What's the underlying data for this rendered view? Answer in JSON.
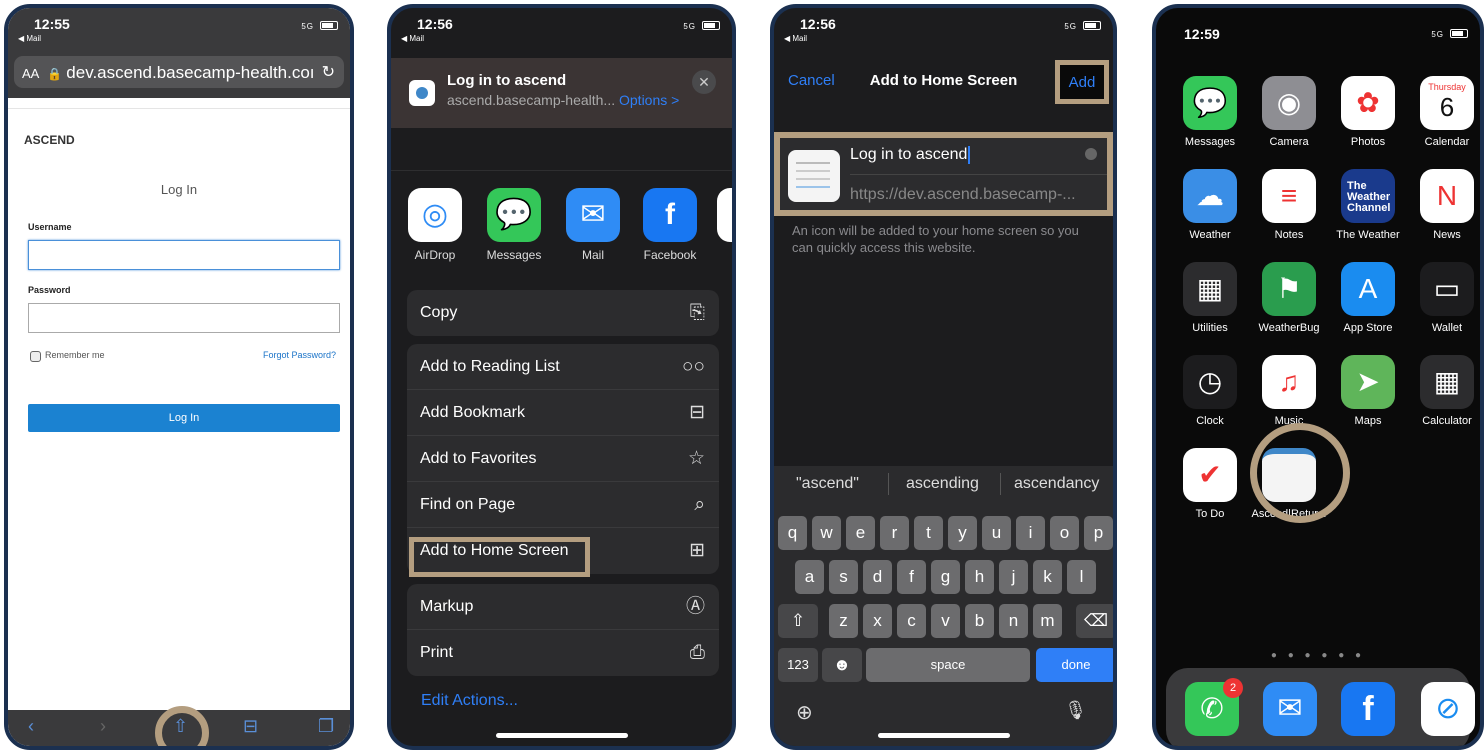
{
  "phone1": {
    "time": "12:55",
    "back_app": "◀ Mail",
    "signal": "5G",
    "url": {
      "text_size": "AA",
      "address": "dev.ascend.basecamp-health.coı"
    },
    "brand": "ASCEND",
    "title": "Log In",
    "username_label": "Username",
    "password_label": "Password",
    "remember": "Remember me",
    "forgot": "Forgot Password?",
    "login_button": "Log In"
  },
  "phone2": {
    "time": "12:56",
    "back_app": "◀ Mail",
    "signal": "5G",
    "sheet_title": "Log in to ascend",
    "sheet_url": "ascend.basecamp-health...",
    "options": "Options >",
    "apps": [
      {
        "label": "AirDrop",
        "icon": "airdrop-icon",
        "color": "#ffffff"
      },
      {
        "label": "Messages",
        "icon": "messages-icon",
        "color": "#34c759"
      },
      {
        "label": "Mail",
        "icon": "mail-icon",
        "color": "#2f8cf5"
      },
      {
        "label": "Facebook",
        "icon": "facebook-icon",
        "color": "#1877f2"
      }
    ],
    "copy": "Copy",
    "actions": [
      "Add to Reading List",
      "Add Bookmark",
      "Add to Favorites",
      "Find on Page",
      "Add to Home Screen"
    ],
    "markup": "Markup",
    "print": "Print",
    "edit_actions": "Edit Actions..."
  },
  "phone3": {
    "time": "12:56",
    "back_app": "◀ Mail",
    "signal": "5G",
    "cancel": "Cancel",
    "title": "Add to Home Screen",
    "add": "Add",
    "name_value": "Log in to ascend",
    "url_value": "https://dev.ascend.basecamp-...",
    "note": "An icon will be added to your home screen so you can quickly access this website.",
    "suggestions": [
      "\"ascend\"",
      "ascending",
      "ascendancy"
    ],
    "keys": {
      "row1": [
        "q",
        "w",
        "e",
        "r",
        "t",
        "y",
        "u",
        "i",
        "o",
        "p"
      ],
      "row2": [
        "a",
        "s",
        "d",
        "f",
        "g",
        "h",
        "j",
        "k",
        "l"
      ],
      "row3": [
        "z",
        "x",
        "c",
        "v",
        "b",
        "n",
        "m"
      ],
      "numbers": "123",
      "space": "space",
      "done": "done"
    }
  },
  "phone4": {
    "time": "12:59",
    "signal": "5G",
    "calendar_day": "Thursday",
    "calendar_date": "6",
    "apps": [
      {
        "label": "Messages",
        "color": "#34c759"
      },
      {
        "label": "Camera",
        "color": "#8e8e93"
      },
      {
        "label": "Photos",
        "color": "#ffffff"
      },
      {
        "label": "Calendar",
        "color": "#ffffff"
      },
      {
        "label": "Weather",
        "color": "#3a8ee6"
      },
      {
        "label": "Notes",
        "color": "#ffffff"
      },
      {
        "label": "The Weather",
        "color": "#1a3a8c"
      },
      {
        "label": "News",
        "color": "#ffffff"
      },
      {
        "label": "Utilities",
        "color": "#2c2c2e"
      },
      {
        "label": "WeatherBug",
        "color": "#2a9d4e"
      },
      {
        "label": "App Store",
        "color": "#1a8cf0"
      },
      {
        "label": "Wallet",
        "color": "#1c1c1e"
      },
      {
        "label": "Clock",
        "color": "#1c1c1e"
      },
      {
        "label": "Music",
        "color": "#ffffff"
      },
      {
        "label": "Maps",
        "color": "#5fb55a"
      },
      {
        "label": "Calculator",
        "color": "#2c2c2e"
      },
      {
        "label": "To Do",
        "color": "#ffffff"
      },
      {
        "label": "Ascend|Retur...",
        "color": "#f4f4f4"
      }
    ],
    "weather_channel_text": "The Weather Channel",
    "dock": [
      {
        "name": "phone",
        "color": "#34c759",
        "badge": "2"
      },
      {
        "name": "mail",
        "color": "#2f8cf5"
      },
      {
        "name": "facebook",
        "color": "#1877f2"
      },
      {
        "name": "safari",
        "color": "#ffffff"
      }
    ]
  }
}
